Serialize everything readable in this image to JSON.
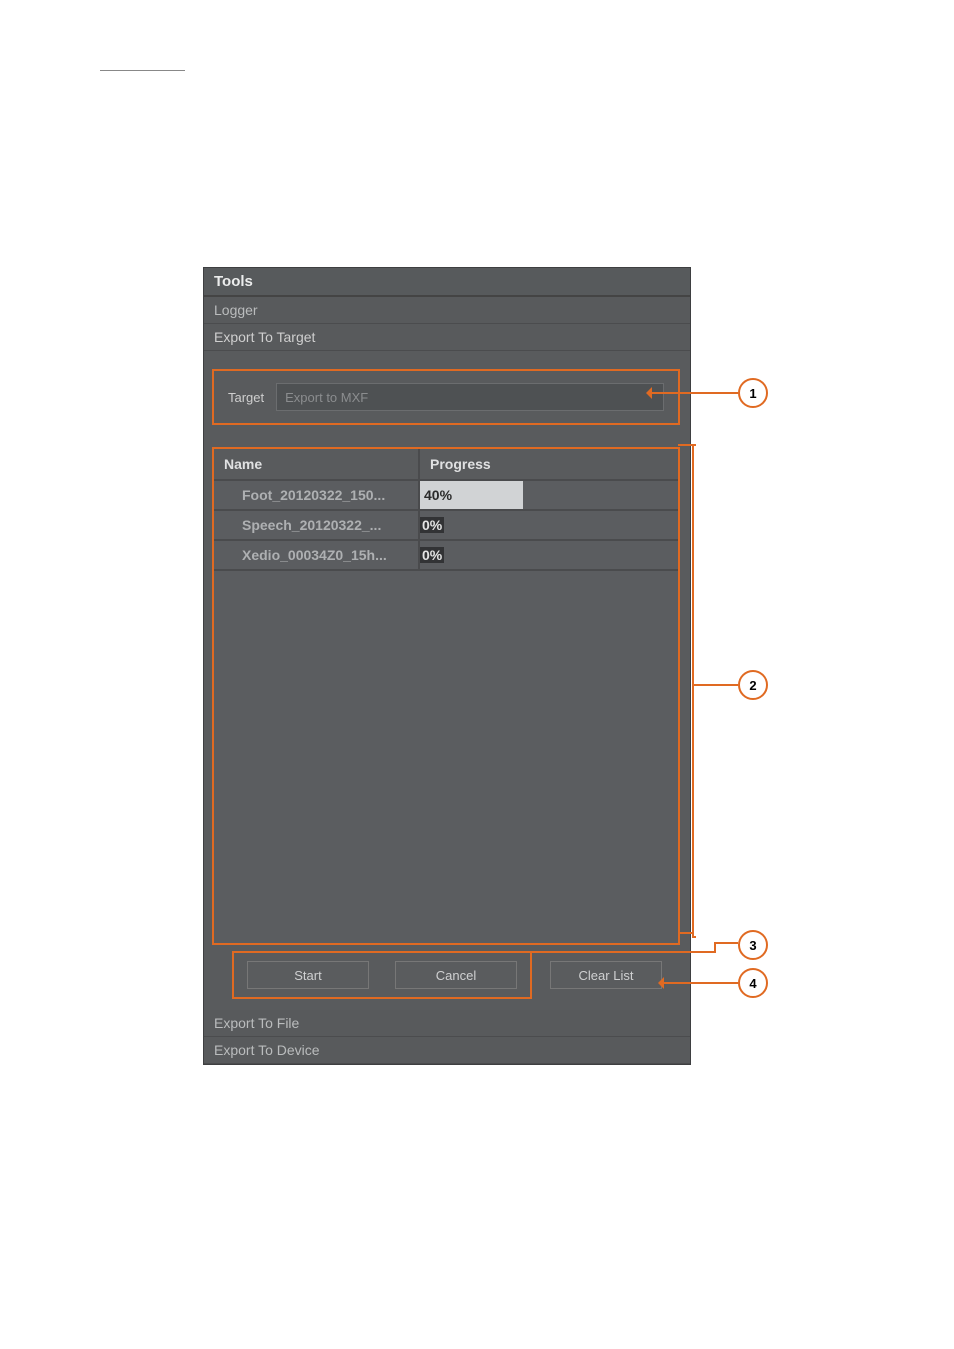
{
  "panel": {
    "title": "Tools",
    "menu": {
      "logger": "Logger",
      "export_target": "Export To Target",
      "export_file": "Export To File",
      "export_device": "Export To Device"
    }
  },
  "target": {
    "label": "Target",
    "value": "Export to MXF"
  },
  "list": {
    "headers": {
      "name": "Name",
      "progress": "Progress"
    },
    "rows": [
      {
        "name": "Foot_20120322_150...",
        "progress_text": "40%",
        "progress_pct": 40
      },
      {
        "name": "Speech_20120322_...",
        "progress_text": "0%",
        "progress_pct": 0
      },
      {
        "name": "Xedio_00034Z0_15h...",
        "progress_text": "0%",
        "progress_pct": 0
      }
    ]
  },
  "buttons": {
    "start": "Start",
    "cancel": "Cancel",
    "clear": "Clear List"
  },
  "annotations": {
    "n1": "1",
    "n2": "2",
    "n3": "3",
    "n4": "4"
  }
}
